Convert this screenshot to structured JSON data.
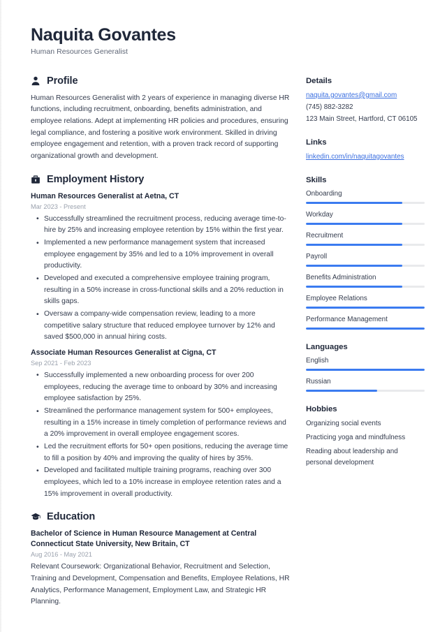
{
  "header": {
    "name": "Naquita Govantes",
    "job_title": "Human Resources Generalist"
  },
  "accent_color": "#3b7bf0",
  "link_color": "#3b6fe0",
  "main": {
    "profile": {
      "icon": "person-icon",
      "title": "Profile",
      "text": "Human Resources Generalist with 2 years of experience in managing diverse HR functions, including recruitment, onboarding, benefits administration, and employee relations. Adept at implementing HR policies and procedures, ensuring legal compliance, and fostering a positive work environment. Skilled in driving employee engagement and retention, with a proven track record of supporting organizational growth and development."
    },
    "employment": {
      "icon": "briefcase-icon",
      "title": "Employment History",
      "entries": [
        {
          "title": "Human Resources Generalist at Aetna, CT",
          "date": "Mar 2023 - Present",
          "bullets": [
            "Successfully streamlined the recruitment process, reducing average time-to-hire by 25% and increasing employee retention by 15% within the first year.",
            "Implemented a new performance management system that increased employee engagement by 35% and led to a 10% improvement in overall productivity.",
            "Developed and executed a comprehensive employee training program, resulting in a 50% increase in cross-functional skills and a 20% reduction in skills gaps.",
            "Oversaw a company-wide compensation review, leading to a more competitive salary structure that reduced employee turnover by 12% and saved $500,000 in annual hiring costs."
          ]
        },
        {
          "title": "Associate Human Resources Generalist at Cigna, CT",
          "date": "Sep 2021 - Feb 2023",
          "bullets": [
            "Successfully implemented a new onboarding process for over 200 employees, reducing the average time to onboard by 30% and increasing employee satisfaction by 25%.",
            "Streamlined the performance management system for 500+ employees, resulting in a 15% increase in timely completion of performance reviews and a 20% improvement in overall employee engagement scores.",
            "Led the recruitment efforts for 50+ open positions, reducing the average time to fill a position by 40% and improving the quality of hires by 35%.",
            "Developed and facilitated multiple training programs, reaching over 300 employees, which led to a 10% increase in employee retention rates and a 15% improvement in overall productivity."
          ]
        }
      ]
    },
    "education": {
      "icon": "graduation-cap-icon",
      "title": "Education",
      "entries": [
        {
          "title": "Bachelor of Science in Human Resource Management at Central Connecticut State University, New Britain, CT",
          "date": "Aug 2016 - May 2021",
          "description": "Relevant Coursework: Organizational Behavior, Recruitment and Selection, Training and Development, Compensation and Benefits, Employee Relations, HR Analytics, Performance Management, Employment Law, and Strategic HR Planning."
        }
      ]
    }
  },
  "sidebar": {
    "details": {
      "title": "Details",
      "email": "naquita.govantes@gmail.com",
      "phone": "(745) 882-3282",
      "address": "123 Main Street, Hartford, CT 06105"
    },
    "links": {
      "title": "Links",
      "items": [
        {
          "label": "linkedin.com/in/naquitagovantes"
        }
      ]
    },
    "skills": {
      "title": "Skills",
      "items": [
        {
          "label": "Onboarding",
          "level": 81
        },
        {
          "label": "Workday",
          "level": 81
        },
        {
          "label": "Recruitment",
          "level": 81
        },
        {
          "label": "Payroll",
          "level": 81
        },
        {
          "label": "Benefits Administration",
          "level": 81
        },
        {
          "label": "Employee Relations",
          "level": 100
        },
        {
          "label": "Performance Management",
          "level": 100
        }
      ]
    },
    "languages": {
      "title": "Languages",
      "items": [
        {
          "label": "English",
          "level": 100
        },
        {
          "label": "Russian",
          "level": 60
        }
      ]
    },
    "hobbies": {
      "title": "Hobbies",
      "items": [
        "Organizing social events",
        "Practicing yoga and mindfulness",
        "Reading about leadership and personal development"
      ]
    }
  }
}
